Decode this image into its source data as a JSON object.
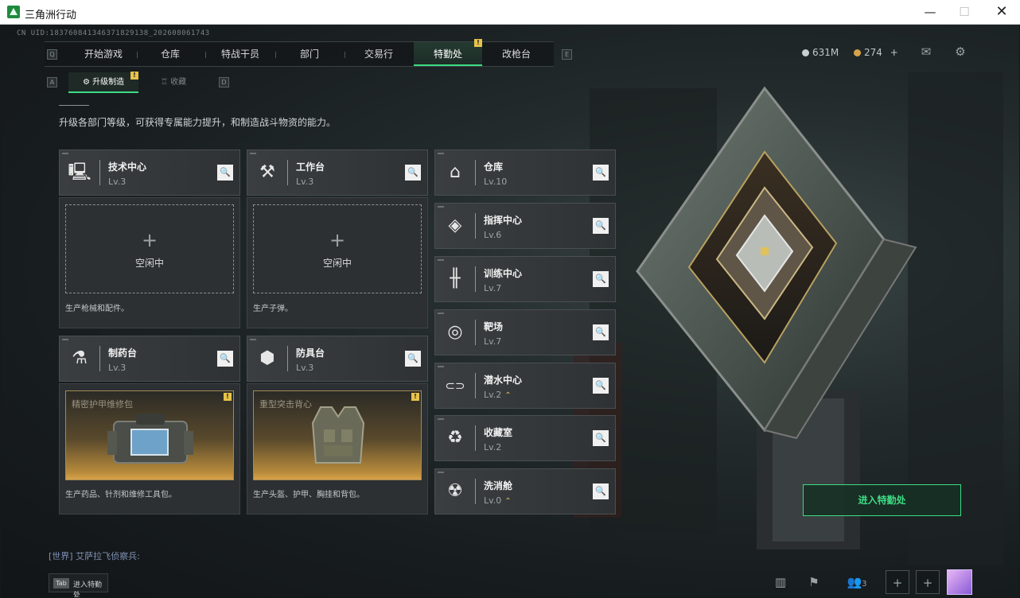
{
  "window": {
    "title": "三角洲行动",
    "min": "—",
    "max": "☐",
    "close": "✕"
  },
  "uid": "CN UID:18376084134637182913​8_2026080617​43",
  "nav": {
    "left_key": "Q",
    "right_key": "E",
    "tabs": [
      "开始游戏",
      "仓库",
      "特战干员",
      "部门",
      "交易行",
      "特勤处",
      "改枪台"
    ],
    "active_badge": "!"
  },
  "resources": {
    "currency1": "631M",
    "currency2": "274",
    "currency2_plus": "+"
  },
  "subnav": {
    "left_key": "A",
    "right_key": "D",
    "tabs": [
      "升级制造",
      "收藏"
    ],
    "badge": "!"
  },
  "intro": "升级各部门等级，可获得专属能力提升，和制造战斗物资的能力。",
  "work_cards": [
    {
      "name": "技术中心",
      "level": "Lv.3",
      "icon": "monitor-icon",
      "glyph": "🖳",
      "plus": "+",
      "status": "空闲中",
      "desc": "生产枪械和配件。"
    },
    {
      "name": "工作台",
      "level": "Lv.3",
      "icon": "tools-icon",
      "glyph": "⚒",
      "plus": "+",
      "status": "空闲中",
      "desc": "生产子弹。"
    },
    {
      "name": "制药台",
      "level": "Lv.3",
      "icon": "microscope-icon",
      "glyph": "⚗",
      "product": "精密护甲维修包",
      "badge": "!",
      "desc": "生产药品、针剂和维修工具包。"
    },
    {
      "name": "防具台",
      "level": "Lv.3",
      "icon": "cubes-icon",
      "glyph": "⬢",
      "product": "重型突击背心",
      "badge": "!",
      "desc": "生产头盔、护甲、胸挂和背包。"
    }
  ],
  "facilities": [
    {
      "name": "仓库",
      "level": "Lv.10",
      "icon": "warehouse-icon",
      "glyph": "⌂",
      "upgrade": ""
    },
    {
      "name": "指挥中心",
      "level": "Lv.6",
      "icon": "command-icon",
      "glyph": "◈",
      "upgrade": ""
    },
    {
      "name": "训练中心",
      "level": "Lv.7",
      "icon": "dumbbell-icon",
      "glyph": "╫",
      "upgrade": ""
    },
    {
      "name": "靶场",
      "level": "Lv.7",
      "icon": "target-icon",
      "glyph": "◎",
      "upgrade": ""
    },
    {
      "name": "潜水中心",
      "level": "Lv.2",
      "icon": "diving-mask-icon",
      "glyph": "⊂⊃",
      "upgrade": "⌃"
    },
    {
      "name": "收藏室",
      "level": "Lv.2",
      "icon": "collection-icon",
      "glyph": "♻",
      "upgrade": ""
    },
    {
      "name": "洗消舱",
      "level": "Lv.0",
      "icon": "decon-icon",
      "glyph": "☢",
      "upgrade": "⌃"
    }
  ],
  "search_glyph": "🔍",
  "enter_button": "进入特勤处",
  "chat": "[世界] 艾萨拉飞侦察兵:",
  "tab_hint": {
    "key": "Tab",
    "label": "进入特勤处"
  },
  "bottom": {
    "friends_count": "3",
    "plus": "+"
  },
  "colors": {
    "accent": "#3ddc84",
    "badge": "#e6c34a",
    "product_glow": "#d9a24a"
  }
}
